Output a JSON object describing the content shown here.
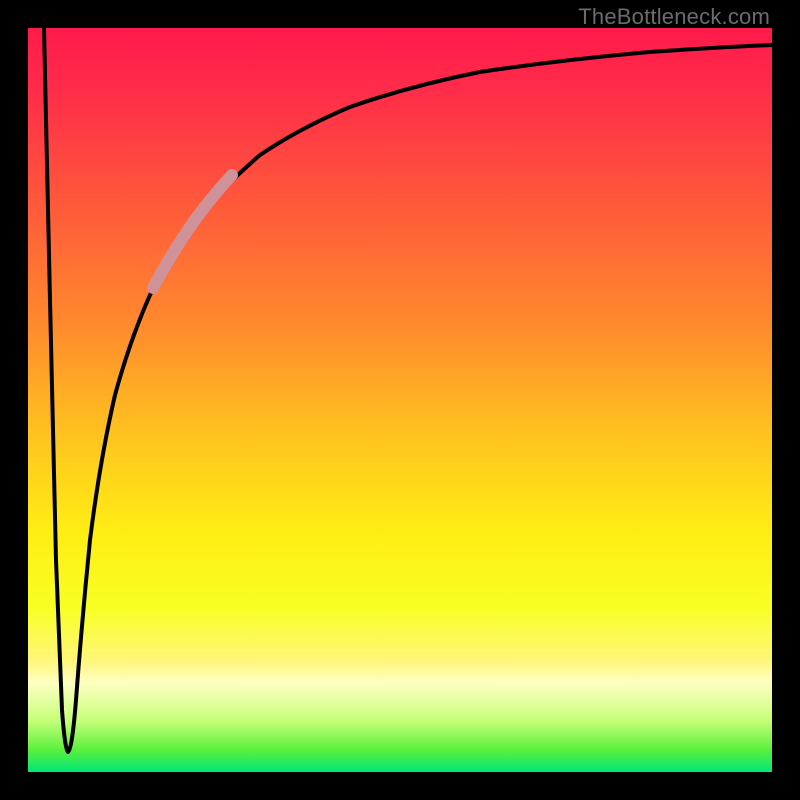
{
  "watermark": "TheBottleneck.com",
  "chart_data": {
    "type": "line",
    "title": "",
    "xlabel": "",
    "ylabel": "",
    "xlim": [
      0,
      100
    ],
    "ylim": [
      0,
      100
    ],
    "grid": false,
    "legend": false,
    "series": [
      {
        "name": "bottleneck-curve",
        "x": [
          2,
          3,
          4,
          5,
          6,
          7,
          8,
          10,
          12,
          15,
          18,
          22,
          26,
          30,
          35,
          40,
          50,
          60,
          70,
          80,
          90,
          100
        ],
        "y": [
          100,
          50,
          10,
          3,
          15,
          30,
          42,
          55,
          62,
          70,
          75,
          80,
          84,
          86,
          88.5,
          90,
          92,
          93.5,
          94.5,
          95.3,
          95.8,
          96.2
        ]
      }
    ],
    "highlight_segment": {
      "series": "bottleneck-curve",
      "x_range": [
        17,
        24
      ],
      "color": "#d99aa0"
    },
    "background_gradient": {
      "orientation": "vertical",
      "stops": [
        {
          "pos": 0,
          "color": "#ff1a4b"
        },
        {
          "pos": 24,
          "color": "#ff5a3a"
        },
        {
          "pos": 55,
          "color": "#ffc41f"
        },
        {
          "pos": 78,
          "color": "#f8ff24"
        },
        {
          "pos": 88,
          "color": "#fdffc2"
        },
        {
          "pos": 100,
          "color": "#00e676"
        }
      ]
    }
  }
}
